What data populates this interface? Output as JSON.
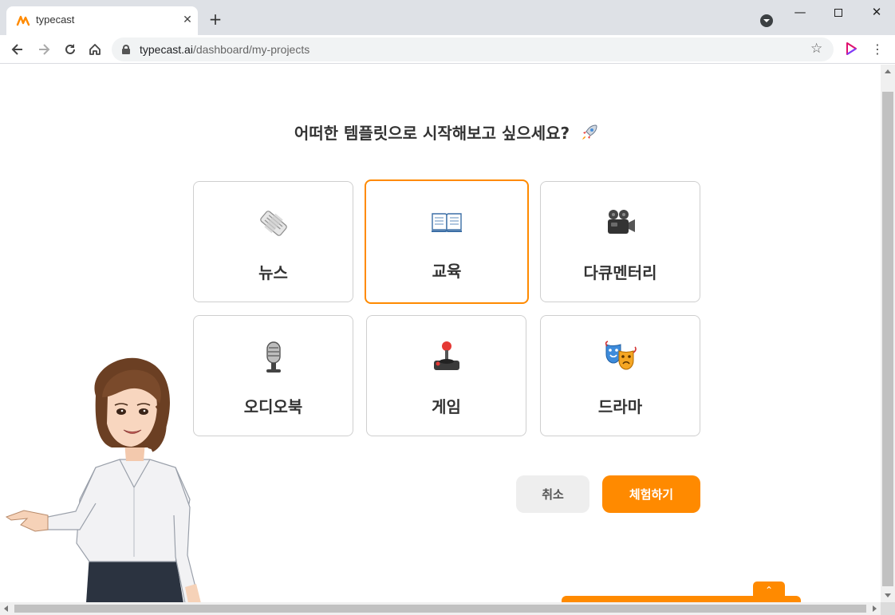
{
  "browser": {
    "tab_title": "typecast",
    "tab_close": "✕",
    "new_tab": "+",
    "url_domain": "typecast.ai",
    "url_path": "/dashboard/my-projects",
    "window_min": "—",
    "window_close": "✕"
  },
  "page": {
    "heading": "어떠한 템플릿으로 시작해보고 싶으세요?",
    "templates": [
      {
        "label": "뉴스",
        "icon": "newspaper-icon"
      },
      {
        "label": "교육",
        "icon": "open-book-icon"
      },
      {
        "label": "다큐멘터리",
        "icon": "movie-camera-icon"
      },
      {
        "label": "오디오북",
        "icon": "microphone-icon"
      },
      {
        "label": "게임",
        "icon": "joystick-icon"
      },
      {
        "label": "드라마",
        "icon": "theater-masks-icon"
      }
    ],
    "selected_template": "교육",
    "cancel_label": "취소",
    "try_label": "체험하기",
    "up_arrow": "⌃"
  },
  "colors": {
    "accent": "#ff8a00",
    "cancel_bg": "#eeeeee",
    "card_border": "#cfcfcf"
  }
}
